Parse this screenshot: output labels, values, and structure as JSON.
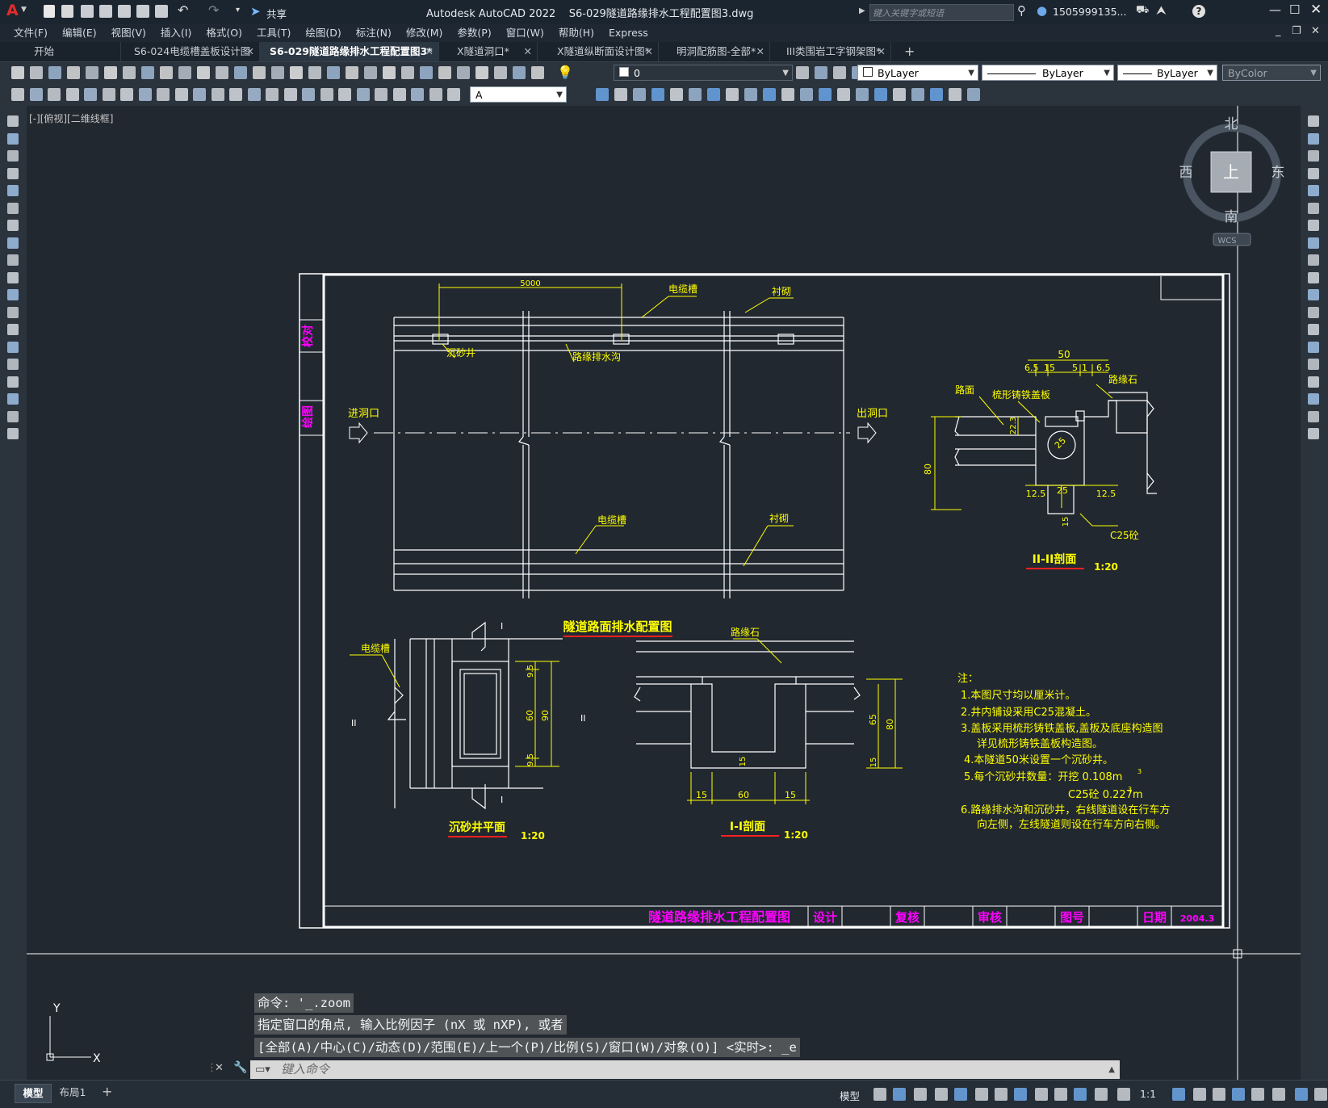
{
  "app": {
    "logo_letter": "A",
    "title": "Autodesk AutoCAD 2022    S6-029隧道路缘排水工程配置图3.dwg",
    "search_placeholder": "键入关键字或短语",
    "user": "1505999135...",
    "share_label": "共享"
  },
  "menu": [
    "文件(F)",
    "编辑(E)",
    "视图(V)",
    "插入(I)",
    "格式(O)",
    "工具(T)",
    "绘图(D)",
    "标注(N)",
    "修改(M)",
    "参数(P)",
    "窗口(W)",
    "帮助(H)",
    "Express"
  ],
  "tabs": [
    {
      "label": "开始",
      "active": false,
      "closable": false
    },
    {
      "label": "S6-024电缆槽盖板设计图",
      "active": false,
      "closable": true
    },
    {
      "label": "S6-029隧道路缘排水工程配置图3*",
      "active": true,
      "closable": true
    },
    {
      "label": "X隧道洞口*",
      "active": false,
      "closable": true
    },
    {
      "label": "X隧道纵断面设计图*",
      "active": false,
      "closable": true
    },
    {
      "label": "明洞配筋图-全部*",
      "active": false,
      "closable": true
    },
    {
      "label": "III类围岩工字钢架图*",
      "active": false,
      "closable": true
    }
  ],
  "properties": {
    "layer": "0",
    "color": "ByLayer",
    "linetype": "ByLayer",
    "lineweight": "ByLayer",
    "plotstyle": "ByColor",
    "textstyle": "A"
  },
  "viewport_label": "[-][俯视][二维线框]",
  "viewcube": {
    "north": "北",
    "south": "南",
    "east": "东",
    "west": "西",
    "top": "上",
    "wcs": "WCS"
  },
  "drawing": {
    "main_title": "隧道路面排水配置图",
    "dim_5000": "5000",
    "cable_trough": "电缆槽",
    "lining": "衬砌",
    "sand_well": "沉砂井",
    "edge_ditch": "路缘排水沟",
    "entrance": "进洞口",
    "exit": "出洞口",
    "curb": "路缘石",
    "road": "路面",
    "cover": "梳形铸铁盖板",
    "c25": "C25砼",
    "sec2_title": "II-II剖面",
    "sec1_title": "I-I剖面",
    "plan_title": "沉砂井平面",
    "scale": "1:20",
    "mark_I": "I",
    "mark_II": "II",
    "dims": {
      "d50": "50",
      "d65": "6.5",
      "d15": "15",
      "d5": "5",
      "d1": "1",
      "d80": "80",
      "d125": "12.5",
      "d25": "25",
      "d223": "22.3",
      "d60": "60",
      "d90": "90",
      "d95": "9.5",
      "d65b": "65"
    },
    "notes": {
      "head": "注：",
      "n1": "1.本图尺寸均以厘米计。",
      "n2": "2.井内铺设采用C25混凝土。",
      "n3a": "3.盖板采用梳形铸铁盖板,盖板及底座构造图",
      "n3b": "详见梳形铸铁盖板构造图。",
      "n4": "4.本隧道50米设置一个沉砂井。",
      "n5a": "5.每个沉砂井数量：开挖  0.108m",
      "n5b": "C25砼  0.227m",
      "sup3": "3",
      "n6a": "6.路缘排水沟和沉砂井，右线隧道设在行车方",
      "n6b": "向左侧，左线隧道则设在行车方向右侧。"
    },
    "titleblock": {
      "name": "隧道路缘排水工程配置图",
      "design": "设计",
      "review": "复核",
      "approve": "审核",
      "drawing_no": "图号",
      "date_label": "日期",
      "date": "2004.3"
    },
    "side_labels": {
      "top": "校对",
      "bottom": "绘图"
    }
  },
  "command": {
    "line1": "命令: '_.zoom",
    "line2": "指定窗口的角点, 输入比例因子 (nX 或 nXP), 或者",
    "line3": "[全部(A)/中心(C)/动态(D)/范围(E)/上一个(P)/比例(S)/窗口(W)/对象(O)] <实时>: _e",
    "input_placeholder": "键入命令"
  },
  "status": {
    "tab_model": "模型",
    "tab_layout1": "布局1",
    "add": "+",
    "model_label": "模型",
    "scale": "1:1"
  },
  "ucs": {
    "x": "X",
    "y": "Y"
  },
  "colors": {
    "yellow": "#ffff00",
    "magenta": "#ff00ff",
    "red": "#ff2020",
    "white": "#ffffff",
    "canvas": "#212830"
  }
}
